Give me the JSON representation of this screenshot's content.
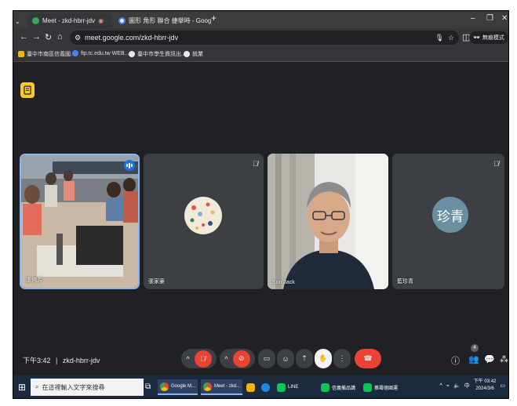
{
  "browser": {
    "tabs": [
      {
        "title": "Meet - zkd-hbrr-jdv",
        "active": true
      },
      {
        "title": "圖形 角形 聯合 捷舉時 - Googl",
        "active": false
      }
    ],
    "new_tab_symbol": "+",
    "url": "meet.google.com/zkd-hbrr-jdv",
    "profile_label": "無痕模式",
    "bookmarks": [
      "臺中市南區信義國...",
      "ftp.tc.edu.tw WEB...",
      "臺中市學生資訊出...",
      "就業"
    ]
  },
  "meet": {
    "participants": [
      {
        "name": "張何芳",
        "type": "video-room",
        "speaking": true,
        "muted": false
      },
      {
        "name": "張家豪",
        "type": "avatar-image",
        "speaking": false,
        "muted": true
      },
      {
        "name": "Sun Jack",
        "type": "video-person",
        "speaking": false,
        "muted": false
      },
      {
        "name": "藍珍青",
        "type": "initials",
        "initials": "珍青",
        "speaking": false,
        "muted": true
      }
    ],
    "time": "下午3:42",
    "separator": "|",
    "meeting_code": "zkd-hbrr-jdv",
    "people_count": "4",
    "colors": {
      "bg": "#202124",
      "tile": "#3c4043",
      "hangup": "#ea4335",
      "note": "#f9c62b",
      "speaking": "#1a73e8",
      "avatar_initials_bg": "#6c8ea3"
    }
  },
  "taskbar": {
    "search_placeholder": "在這裡輸入文字來搜尋",
    "apps": [
      {
        "label": "Google M...",
        "icon": "chrome-icon"
      },
      {
        "label": "Meet - zkd...",
        "icon": "meet-icon"
      },
      {
        "label": "LINE",
        "icon": "line-icon"
      },
      {
        "label": "信義備品講",
        "icon": "line-icon"
      },
      {
        "label": "蔡壽德國運",
        "icon": "line-icon"
      }
    ],
    "input_method": "中",
    "clock_time": "下午 03:42",
    "clock_date": "2024/3/6"
  }
}
